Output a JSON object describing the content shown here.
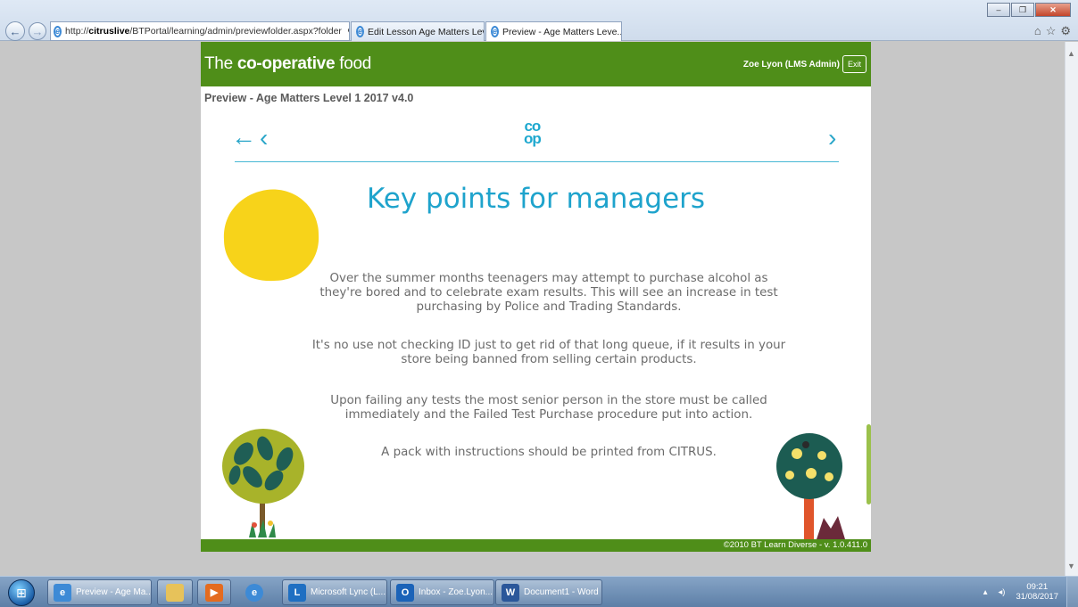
{
  "browser": {
    "url_prefix": "http://",
    "url_host": "citruslive",
    "url_rest": "/BTPortal/learning/admin/previewfolder.aspx?folder",
    "search_glyph": "⚲",
    "dropdown_glyph": "▾",
    "refresh_glyph": "↻",
    "tabs": [
      {
        "label": "Edit Lesson Age Matters Level ..."
      },
      {
        "label": "Preview - Age Matters Leve..."
      }
    ],
    "tab_close": "×",
    "back_glyph": "←",
    "forward_glyph": "→",
    "window": {
      "minimize": "–",
      "maximize": "❐",
      "close": "✕"
    },
    "toolbar_icons": {
      "home": "⌂",
      "favorites": "☆",
      "tools": "⚙"
    }
  },
  "portal": {
    "brand_the": "The",
    "brand_coop": "co-operative",
    "brand_food": "food",
    "user": "Zoe Lyon (LMS Admin)",
    "exit_label": "Exit",
    "preview_title": "Preview - Age Matters Level 1 2017 v4.0",
    "footer": "©2010 BT Learn Diverse - v. 1.0.411.0"
  },
  "lesson": {
    "nav": {
      "back": "←",
      "prev": "‹",
      "next": "›"
    },
    "logo_top": "co",
    "logo_bottom": "op",
    "heading": "Key points for managers",
    "paragraphs": [
      "Over the summer months teenagers may attempt to purchase alcohol as they're bored and to celebrate exam results. This will see an increase in test purchasing by Police and Trading Standards.",
      "It's no use not checking ID just to get rid of that long queue, if it results in your store being banned from selling certain products.",
      "Upon failing any tests the most senior person in the store must be called immediately and the Failed Test Purchase procedure put into action.",
      "A pack with instructions should be printed from CITRUS."
    ],
    "colors": {
      "accent": "#1ea3cc",
      "sun": "#f7d31a",
      "header_green": "#4f8e19"
    }
  },
  "taskbar": {
    "start_glyph": "⊞",
    "items": [
      {
        "label": "Preview - Age Ma...",
        "icon": "ie-icon"
      },
      {
        "label": "",
        "icon": "explorer-icon"
      },
      {
        "label": "",
        "icon": "media-player-icon"
      },
      {
        "label": "",
        "icon": "ie-icon"
      },
      {
        "label": "Microsoft Lync  (L...",
        "icon": "lync-icon"
      },
      {
        "label": "Inbox - Zoe.Lyon...",
        "icon": "outlook-icon"
      },
      {
        "label": "Document1 - Word",
        "icon": "word-icon"
      }
    ],
    "icon_letters": {
      "lync": "L",
      "outlook": "O",
      "word": "W"
    },
    "tray_arrow": "▴",
    "volume": "◂)",
    "time": "09:21",
    "date": "31/08/2017"
  }
}
